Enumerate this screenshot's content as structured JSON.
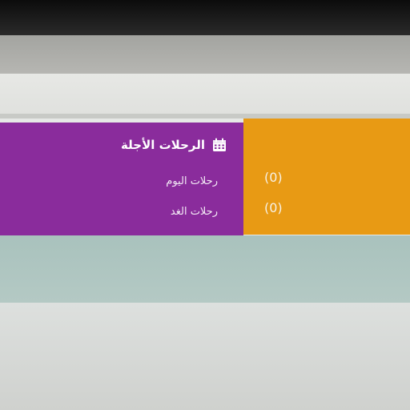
{
  "colors": {
    "purple_panel": "#8a2c9c",
    "orange_panel": "#e89a14",
    "teal_band": "#a9c2bd"
  },
  "upcoming_trips": {
    "icon": "calendar-icon",
    "title": "الرحلات الأجلة",
    "rows": [
      {
        "label": "رحلات اليوم",
        "count": "(0)"
      },
      {
        "label": "رحلات الغد",
        "count": "(0)"
      }
    ]
  }
}
